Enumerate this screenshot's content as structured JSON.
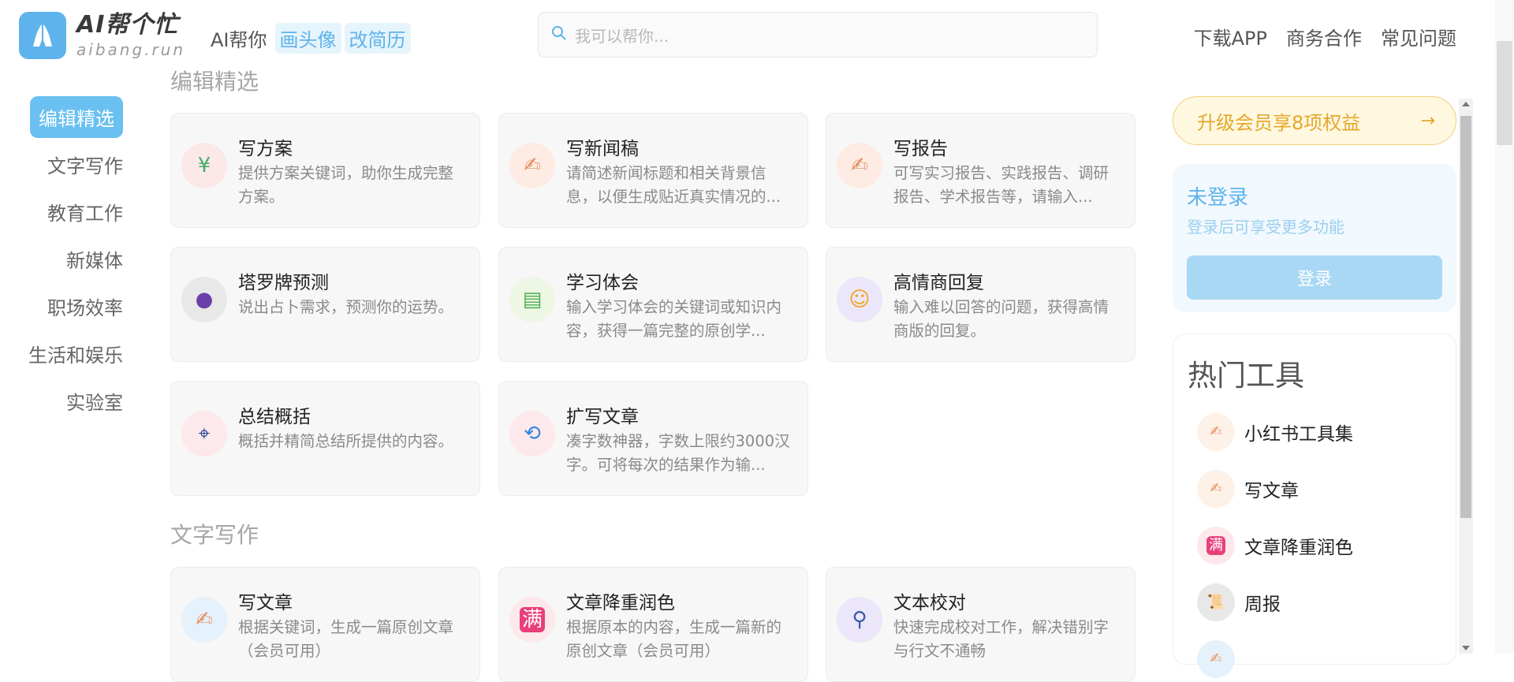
{
  "header": {
    "logo_main": "AI帮个忙",
    "logo_sub": "aibang.run",
    "nav_home": "AI帮你",
    "nav_pills": [
      "画头像",
      "改简历"
    ],
    "search_placeholder": "我可以帮你...",
    "nav_right": [
      "下载APP",
      "商务合作",
      "常见问题"
    ]
  },
  "sidebar": {
    "items": [
      "编辑精选",
      "文字写作",
      "教育工作",
      "新媒体",
      "职场效率",
      "生活和娱乐",
      "实验室"
    ],
    "active": "编辑精选"
  },
  "sections": [
    {
      "title": "编辑精选",
      "cards": [
        {
          "title": "写方案",
          "desc": "提供方案关键词，助你生成完整方案。",
          "icon": "money-icon",
          "icon_glyph": "¥",
          "icon_bg": "#fde8e8",
          "icon_color": "#3fae6a"
        },
        {
          "title": "写新闻稿",
          "desc": "请简述新闻标题和相关背景信息，以便生成贴近真实情况的...",
          "icon": "writing-hand-icon",
          "icon_glyph": "✍",
          "icon_bg": "#fdebe4",
          "icon_color": "#e58d5e"
        },
        {
          "title": "写报告",
          "desc": "可写实习报告、实践报告、调研报告、学术报告等，请输入...",
          "icon": "writing-hand-icon",
          "icon_glyph": "✍",
          "icon_bg": "#fdebe4",
          "icon_color": "#e58d5e"
        },
        {
          "title": "塔罗牌预测",
          "desc": "说出占卜需求，预测你的运势。",
          "icon": "crystal-ball-icon",
          "icon_glyph": "●",
          "icon_bg": "#e8e8e8",
          "icon_color": "#6b3fa8"
        },
        {
          "title": "学习体会",
          "desc": "输入学习体会的关键词或知识内容，获得一篇完整的原创学...",
          "icon": "books-icon",
          "icon_glyph": "▤",
          "icon_bg": "#eef6e4",
          "icon_color": "#4caf50"
        },
        {
          "title": "高情商回复",
          "desc": "输入难以回答的问题，获得高情商版的回复。",
          "icon": "smile-face-icon",
          "icon_glyph": "☺",
          "icon_bg": "#ece6fa",
          "icon_color": "#f1a31c"
        },
        {
          "title": "总结概括",
          "desc": "概括并精简总结所提供的内容。",
          "icon": "telescope-icon",
          "icon_glyph": "⌖",
          "icon_bg": "#fde8ec",
          "icon_color": "#1f3f8c"
        },
        {
          "title": "扩写文章",
          "desc": "凑字数神器，字数上限约3000汉字。可将每次的结果作为输...",
          "icon": "refresh-icon",
          "icon_glyph": "⟲",
          "icon_bg": "#fde8ec",
          "icon_color": "#2f86e0"
        }
      ]
    },
    {
      "title": "文字写作",
      "cards": [
        {
          "title": "写文章",
          "desc": "根据关键词，生成一篇原创文章（会员可用）",
          "icon": "writing-hand-icon",
          "icon_glyph": "✍",
          "icon_bg": "#e6f2fb",
          "icon_color": "#e58d5e"
        },
        {
          "title": "文章降重润色",
          "desc": "根据原本的内容，生成一篇新的原创文章（会员可用）",
          "icon": "full-mark-icon",
          "icon_glyph": "满",
          "icon_bg": "#fde8ec",
          "icon_color": "#ffffff"
        },
        {
          "title": "文本校对",
          "desc": "快速完成校对工作，解决错别字与行文不通畅",
          "icon": "magnifier-icon",
          "icon_glyph": "⚲",
          "icon_bg": "#ece6fa",
          "icon_color": "#3a5ba8"
        }
      ]
    }
  ],
  "right_panel": {
    "upgrade": "升级会员享8项权益",
    "upgrade_arrow": "→",
    "login_title": "未登录",
    "login_sub": "登录后可享受更多功能",
    "login_button": "登录",
    "hot_title": "热门工具",
    "hot_tools": [
      {
        "label": "小红书工具集",
        "icon": "writing-hand-icon",
        "icon_glyph": "✍",
        "icon_bg": "#fdf1e8",
        "icon_color": "#e58d5e"
      },
      {
        "label": "写文章",
        "icon": "writing-hand-icon",
        "icon_glyph": "✍",
        "icon_bg": "#fdf1e8",
        "icon_color": "#e58d5e"
      },
      {
        "label": "文章降重润色",
        "icon": "full-mark-icon",
        "icon_glyph": "满",
        "icon_bg": "#fde8ec",
        "icon_color": "#ffffff"
      },
      {
        "label": "周报",
        "icon": "scroll-icon",
        "icon_glyph": "📜",
        "icon_bg": "#e8e8e8",
        "icon_color": "#c9953f"
      },
      {
        "label": "",
        "icon": "writing-hand-icon",
        "icon_glyph": "✍",
        "icon_bg": "#e6f2fb",
        "icon_color": "#e58d5e"
      }
    ]
  },
  "colors": {
    "accent": "#5fb3ec",
    "upgrade": "#e6a72b"
  }
}
